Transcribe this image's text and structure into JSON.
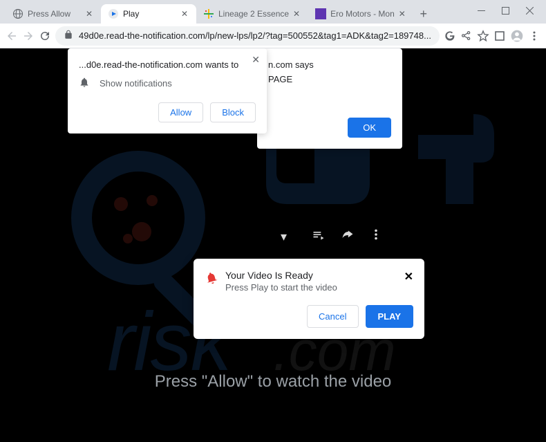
{
  "window": {
    "tabs": [
      {
        "title": "Press Allow",
        "active": false
      },
      {
        "title": "Play",
        "active": true
      },
      {
        "title": "Lineage 2 Essence",
        "active": false
      },
      {
        "title": "Ero Motors - Mon",
        "active": false
      }
    ]
  },
  "toolbar": {
    "url": "49d0e.read-the-notification.com/lp/new-lps/lp2/?tag=500552&tag1=ADK&tag2=189748..."
  },
  "notification_prompt": {
    "site_text": "...d0e.read-the-notification.com wants to",
    "permission_text": "Show notifications",
    "allow_label": "Allow",
    "block_label": "Block"
  },
  "js_alert": {
    "says": "n.com says",
    "message": "PAGE",
    "ok_label": "OK"
  },
  "video_ready": {
    "title": "Your Video Is Ready",
    "subtitle": "Press Play to start the video",
    "cancel_label": "Cancel",
    "play_label": "PLAY"
  },
  "page": {
    "instruction": "Press \"Allow\" to watch the video"
  }
}
